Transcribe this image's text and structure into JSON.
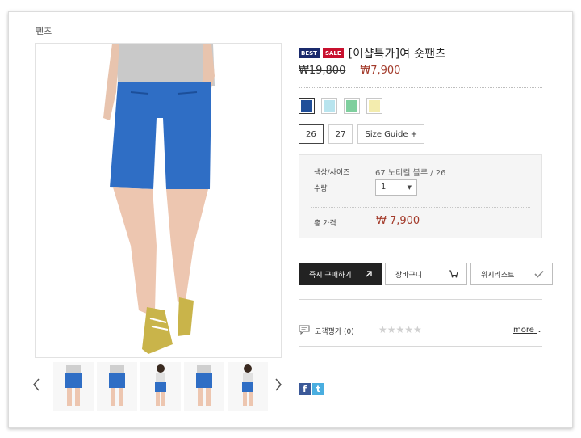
{
  "breadcrumb": "펜츠",
  "product": {
    "badges": [
      {
        "label": "BEST",
        "color": "#1a2a6c"
      },
      {
        "label": "SALE",
        "color": "#c8102e"
      }
    ],
    "name": "[이샵특가]여 숏팬츠",
    "price_original": "₩19,800",
    "price_sale": "₩7,900"
  },
  "colors": [
    {
      "name": "navy-blue",
      "hex": "#1f4e99",
      "selected": true
    },
    {
      "name": "light-sky",
      "hex": "#b8e4ee",
      "selected": false
    },
    {
      "name": "mint-green",
      "hex": "#7fcf9e",
      "selected": false
    },
    {
      "name": "pale-yellow",
      "hex": "#f3ecae",
      "selected": false
    }
  ],
  "sizes": [
    {
      "label": "26",
      "selected": true
    },
    {
      "label": "27",
      "selected": false
    }
  ],
  "size_guide_label": "Size Guide +",
  "options": {
    "color_size_label": "색상/사이즈",
    "color_size_value": "67 노티컬 블루 / 26",
    "qty_label": "수량",
    "qty_value": "1",
    "total_label": "총 가격",
    "total_value": "₩ 7,900"
  },
  "buttons": {
    "buy_now": "즉시 구매하기",
    "cart": "장바구니",
    "wishlist": "위시리스트"
  },
  "reviews": {
    "label": "고객평가 (0)",
    "stars": "★★★★★",
    "more": "more"
  },
  "share": {
    "facebook": "f",
    "twitter": "t"
  },
  "thumbnails_count": 5
}
